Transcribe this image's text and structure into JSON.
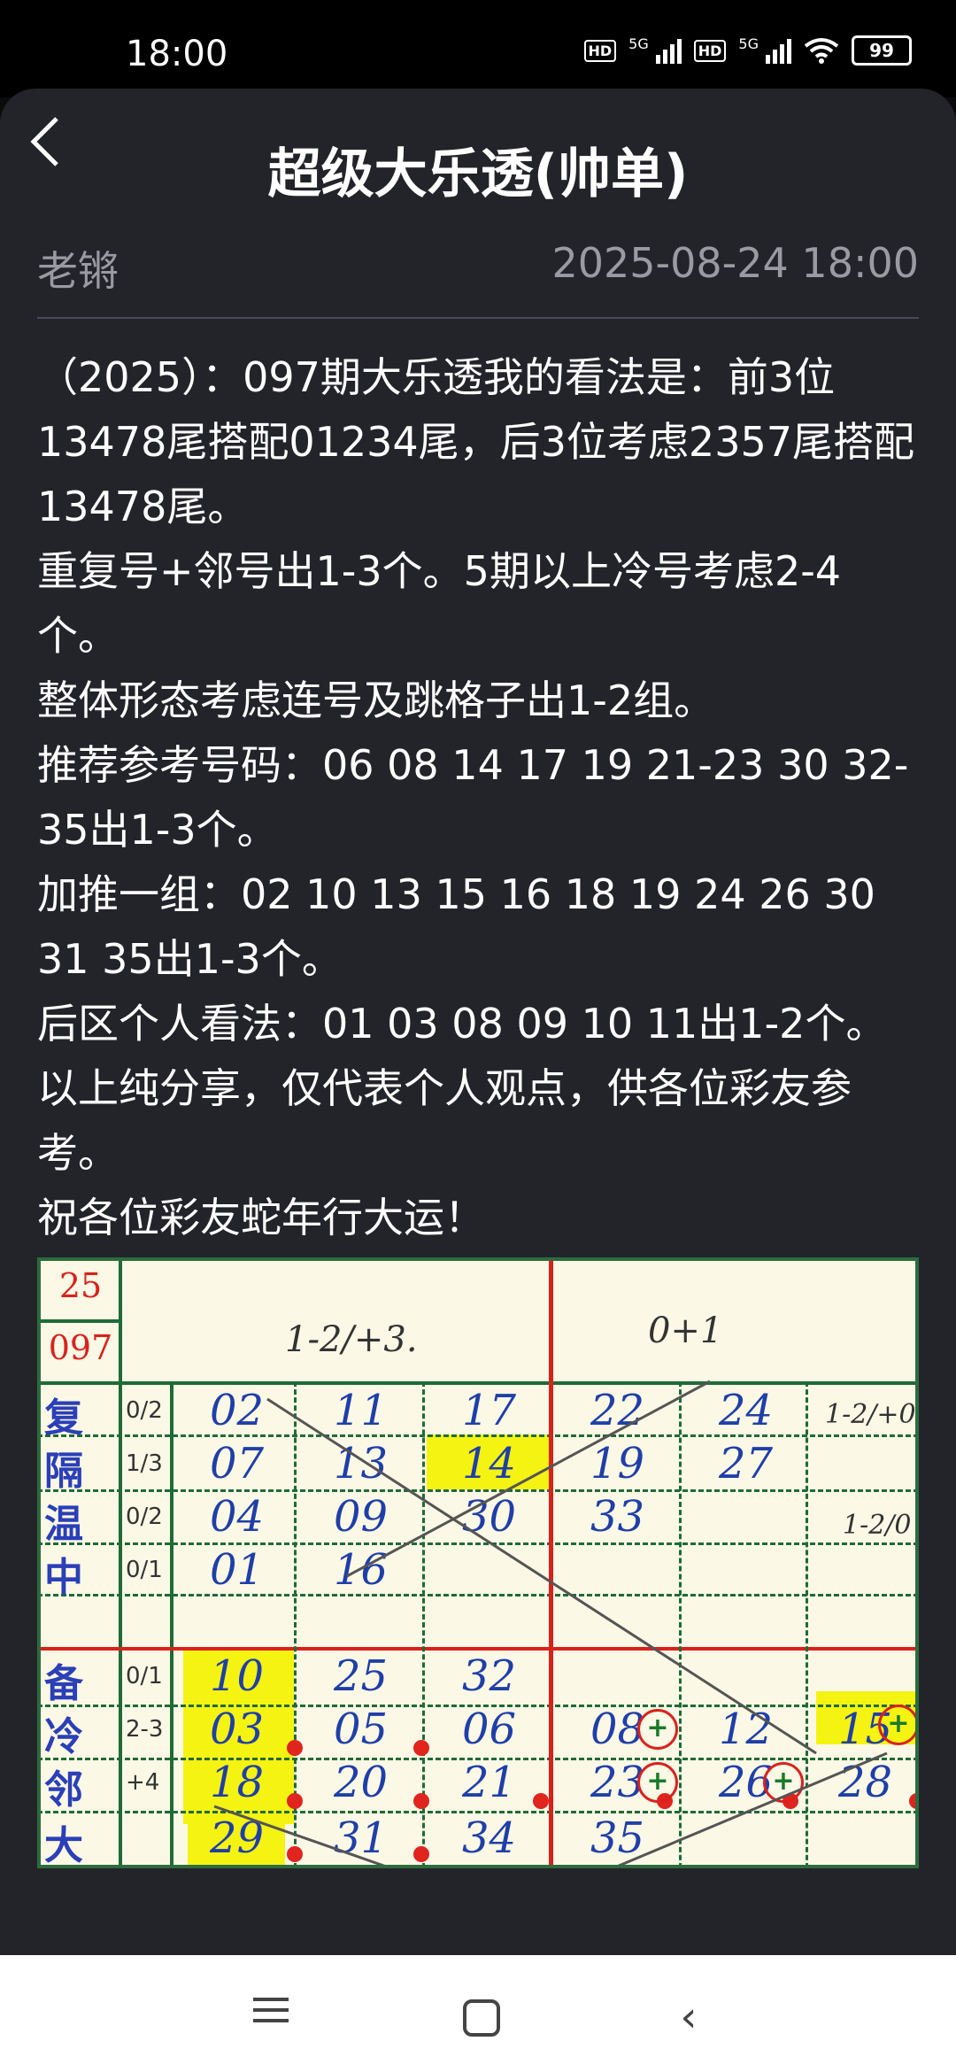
{
  "status": {
    "time": "18:00",
    "battery": "99",
    "net1": "5G",
    "net2": "5G",
    "hd": "HD"
  },
  "header": {
    "title": "超级大乐透(帅单)"
  },
  "meta": {
    "author": "老锵",
    "date": "2025-08-24 18:00"
  },
  "content": {
    "paragraphs": [
      "（2025）：097期大乐透我的看法是：前3位13478尾搭配01234尾，后3位考虑2357尾搭配13478尾。",
      "重复号+邻号出1-3个。5期以上冷号考虑2-4个。",
      "整体形态考虑连号及跳格子出1-2组。",
      "推荐参考号码：06 08 14 17 19 21-23 30 32-35出1-3个。",
      "加推一组：02 10 13 15 16 18 19 24 26 30 31 35出1-3个。",
      "后区个人看法：01 03 08 09 10 11出1-2个。",
      "以上纯分享，仅代表个人观点，供各位彩友参考。",
      "祝各位彩友蛇年行大运！"
    ]
  },
  "photo": {
    "year": "25",
    "issue": "097",
    "header_left": "1-2/+3.",
    "header_right": "0+1",
    "row_labels": [
      "复",
      "隔",
      "温",
      "中",
      "备",
      "冷",
      "邻",
      "大"
    ],
    "row_tags": [
      "0/2",
      "1/3",
      "0/2",
      "0/1",
      "0/1",
      "2-3",
      "+4",
      ""
    ],
    "cells": [
      [
        "02",
        "11",
        "17",
        "22",
        "24",
        ""
      ],
      [
        "07",
        "13",
        "14",
        "19",
        "27",
        ""
      ],
      [
        "04",
        "09",
        "30",
        "33",
        "",
        ""
      ],
      [
        "01",
        "16",
        "",
        "",
        "",
        ""
      ],
      [
        "10",
        "25",
        "32",
        "",
        "",
        ""
      ],
      [
        "03",
        "05",
        "06",
        "08",
        "12",
        "15"
      ],
      [
        "18",
        "20",
        "21",
        "23",
        "26",
        "28"
      ],
      [
        "29",
        "31",
        "34",
        "35",
        "",
        ""
      ]
    ],
    "side_notes": [
      "1-2/+0",
      "1-2/0"
    ]
  },
  "nav": {
    "menu": "menu-icon",
    "home": "home-icon",
    "back": "back-icon"
  }
}
